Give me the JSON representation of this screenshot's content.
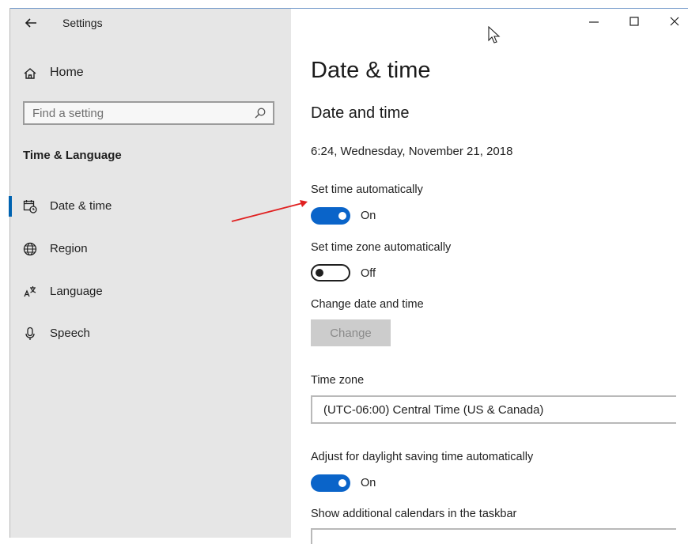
{
  "window": {
    "title": "Settings",
    "controls": {
      "minimize": "—",
      "maximize": "☐",
      "close": "✕"
    }
  },
  "sidebar": {
    "home_label": "Home",
    "search_placeholder": "Find a setting",
    "section_title": "Time & Language",
    "items": [
      {
        "label": "Date & time",
        "icon": "calendar-clock-icon",
        "active": true
      },
      {
        "label": "Region",
        "icon": "globe-icon"
      },
      {
        "label": "Language",
        "icon": "language-icon"
      },
      {
        "label": "Speech",
        "icon": "microphone-icon"
      }
    ]
  },
  "main": {
    "page_title": "Date & time",
    "section_title": "Date and time",
    "current_datetime": "6:24, Wednesday, November 21, 2018",
    "set_time_auto": {
      "label": "Set time automatically",
      "state": "On"
    },
    "set_timezone_auto": {
      "label": "Set time zone automatically",
      "state": "Off"
    },
    "change_date": {
      "label": "Change date and time",
      "button": "Change"
    },
    "time_zone": {
      "label": "Time zone",
      "value": "(UTC-06:00) Central Time (US & Canada)"
    },
    "daylight": {
      "label": "Adjust for daylight saving time automatically",
      "state": "On"
    },
    "calendars": {
      "label": "Show additional calendars in the taskbar"
    }
  },
  "colors": {
    "accent": "#0a64c9",
    "sidebar_bg": "#e6e6e6",
    "annotation_arrow": "#e02020"
  }
}
